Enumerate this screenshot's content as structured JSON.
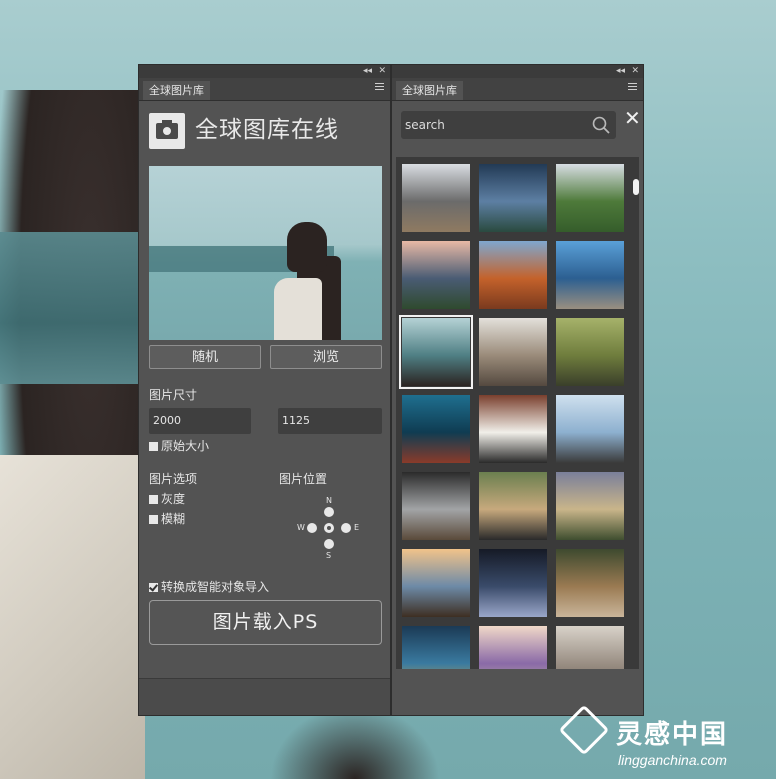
{
  "left_panel": {
    "tab_label": "全球图片库",
    "title": "全球图库在线",
    "buttons": {
      "random": "随机",
      "browse": "浏览",
      "load": "图片载入PS"
    },
    "size": {
      "label": "图片尺寸",
      "width": "2000",
      "height": "1125",
      "original_size_label": "原始大小",
      "original_size_checked": false
    },
    "options": {
      "label": "图片选项",
      "grayscale_label": "灰度",
      "grayscale_checked": false,
      "blur_label": "模糊",
      "blur_checked": false
    },
    "position": {
      "label": "图片位置",
      "north": "N",
      "south": "S",
      "east": "E",
      "west": "W"
    },
    "smart_object": {
      "label": "转换成智能对象导入",
      "checked": true
    }
  },
  "right_panel": {
    "tab_label": "全球图片库",
    "search": {
      "placeholder": "search"
    },
    "thumbnails": [
      {
        "name": "beaver-on-rocks",
        "colors": [
          "#d9dde2",
          "#6b6b6b",
          "#8f7a61"
        ]
      },
      {
        "name": "stormy-sky-landscape",
        "colors": [
          "#223a55",
          "#5d7fa3",
          "#2a4a3f"
        ]
      },
      {
        "name": "green-cliffs",
        "colors": [
          "#d7dde3",
          "#4e7a3a",
          "#355d2b"
        ]
      },
      {
        "name": "mountain-lake-dusk",
        "colors": [
          "#e8b9a6",
          "#4a5c74",
          "#2f4a2e"
        ]
      },
      {
        "name": "orange-canyon",
        "colors": [
          "#7fa7cf",
          "#c4622b",
          "#7a3a1e"
        ]
      },
      {
        "name": "fjord-cliff",
        "colors": [
          "#5aa0d8",
          "#2c5f91",
          "#9a8f80"
        ]
      },
      {
        "name": "blindfold-woman",
        "colors": [
          "#b5d2d5",
          "#4f7f84",
          "#2b2321"
        ]
      },
      {
        "name": "car-interior",
        "colors": [
          "#e3e0da",
          "#9a8b7a",
          "#54493f"
        ]
      },
      {
        "name": "field-with-dog",
        "colors": [
          "#a6b26a",
          "#6f7d3d",
          "#3a3f2a"
        ]
      },
      {
        "name": "canoe-lake",
        "colors": [
          "#1f6f8f",
          "#0f3c52",
          "#8a3b2a"
        ]
      },
      {
        "name": "reading-in-bed",
        "colors": [
          "#7a3f2d",
          "#f1efe9",
          "#2a2a2a"
        ]
      },
      {
        "name": "man-by-sea",
        "colors": [
          "#cfe0ee",
          "#8db0cf",
          "#3a3a3a"
        ]
      },
      {
        "name": "window-room",
        "colors": [
          "#2b2b2b",
          "#a2a4a6",
          "#5a4a3a"
        ]
      },
      {
        "name": "bridge-walk",
        "colors": [
          "#6b7f4f",
          "#c7a97d",
          "#2a2a2a"
        ]
      },
      {
        "name": "hillside-sunset",
        "colors": [
          "#7a7f9a",
          "#c9b58a",
          "#3f4e2f"
        ]
      },
      {
        "name": "beach-portrait",
        "colors": [
          "#f1c38a",
          "#6d8aa7",
          "#3e2e22"
        ]
      },
      {
        "name": "night-forest",
        "colors": [
          "#151a26",
          "#3a4b6a",
          "#9aa7c9"
        ]
      },
      {
        "name": "deer-in-forest",
        "colors": [
          "#3e4a2f",
          "#9a7a52",
          "#c9b59a"
        ]
      },
      {
        "name": "abstract-blue",
        "colors": [
          "#1b3a55",
          "#3a7aa0",
          "#caa84a"
        ]
      },
      {
        "name": "beach-walk",
        "colors": [
          "#f0d8c8",
          "#8a6aa7",
          "#c7b7a6"
        ]
      },
      {
        "name": "misty-shore",
        "colors": [
          "#d8d2c9",
          "#9a8f84",
          "#6a5e54"
        ]
      }
    ]
  },
  "watermark": {
    "title": "灵感中国",
    "subtitle": "lingganchina.com"
  },
  "accent_color": "#535353"
}
